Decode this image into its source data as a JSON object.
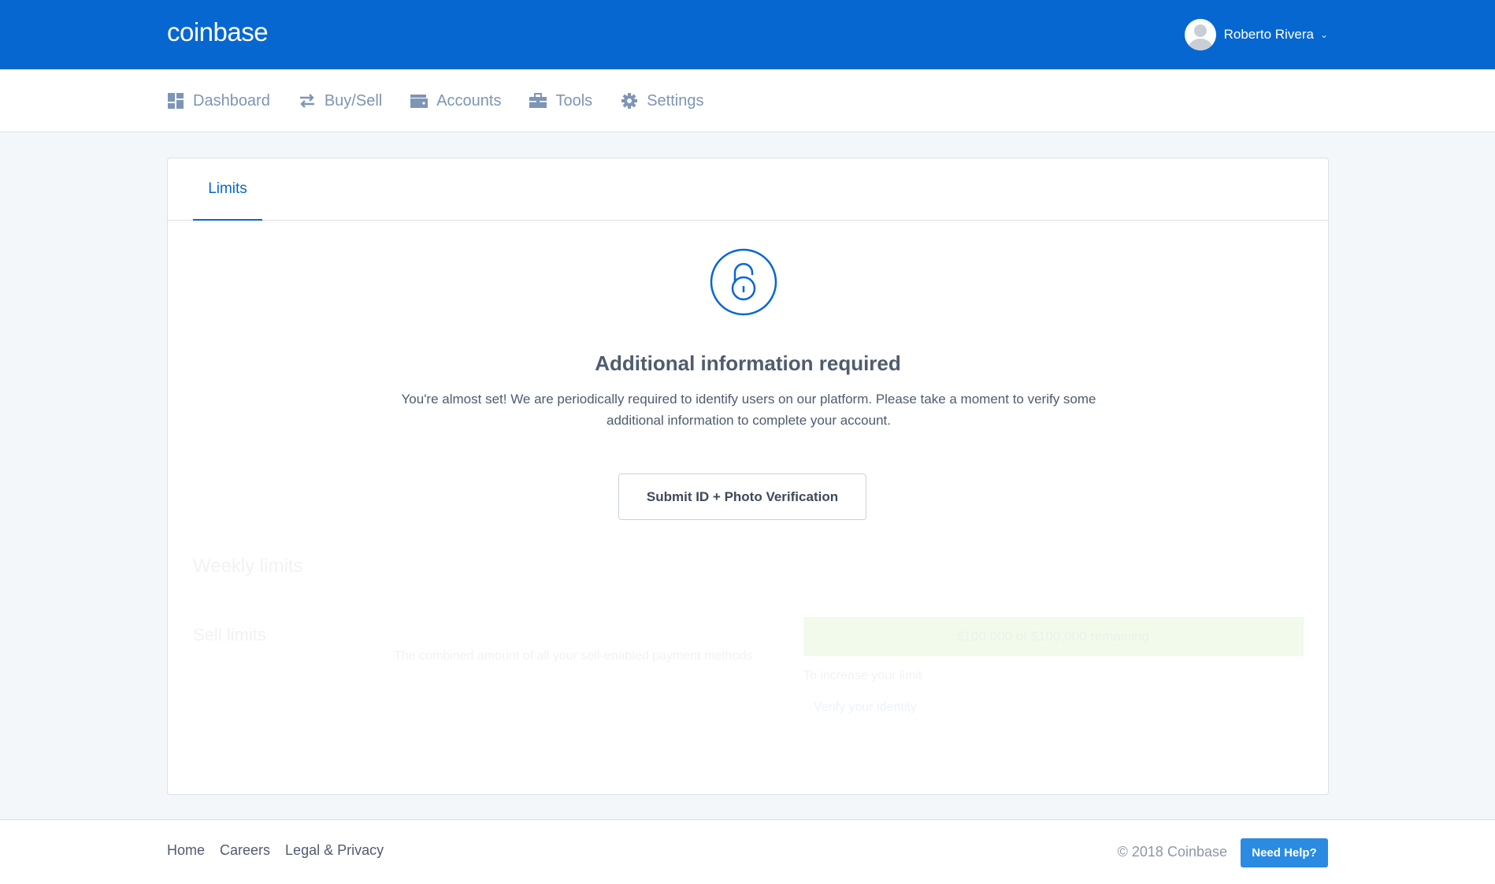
{
  "header": {
    "logo": "coinbase",
    "user_name": "Roberto Rivera"
  },
  "nav": {
    "items": [
      {
        "label": "Dashboard",
        "icon": "dashboard-icon"
      },
      {
        "label": "Buy/Sell",
        "icon": "swap-arrows-icon"
      },
      {
        "label": "Accounts",
        "icon": "wallet-icon"
      },
      {
        "label": "Tools",
        "icon": "briefcase-icon"
      },
      {
        "label": "Settings",
        "icon": "gear-icon"
      }
    ]
  },
  "tabs": {
    "active": "Limits"
  },
  "verification": {
    "icon": "lock-icon",
    "heading": "Additional information required",
    "body": "You're almost set! We are periodically required to identify users on our platform. Please take a moment to verify some additional information to complete your account.",
    "button_label": "Submit ID + Photo Verification"
  },
  "limits": {
    "section_title": "Weekly limits",
    "sell_title": "Sell limits",
    "sell_description": "The combined amount of all your sell-enabled payment methods",
    "remaining": "$100,000 of $100,000 remaining",
    "increase_text": "To increase your limit",
    "verify_link": "Verify your identity"
  },
  "footer": {
    "links": [
      "Home",
      "Careers",
      "Legal & Privacy"
    ],
    "copyright": "© 2018 Coinbase",
    "help_label": "Need Help?"
  },
  "colors": {
    "brand": "#0667d0",
    "nav_text": "#7d95b6",
    "help_button": "#2b8be2",
    "limit_bar": "#61ca00"
  }
}
